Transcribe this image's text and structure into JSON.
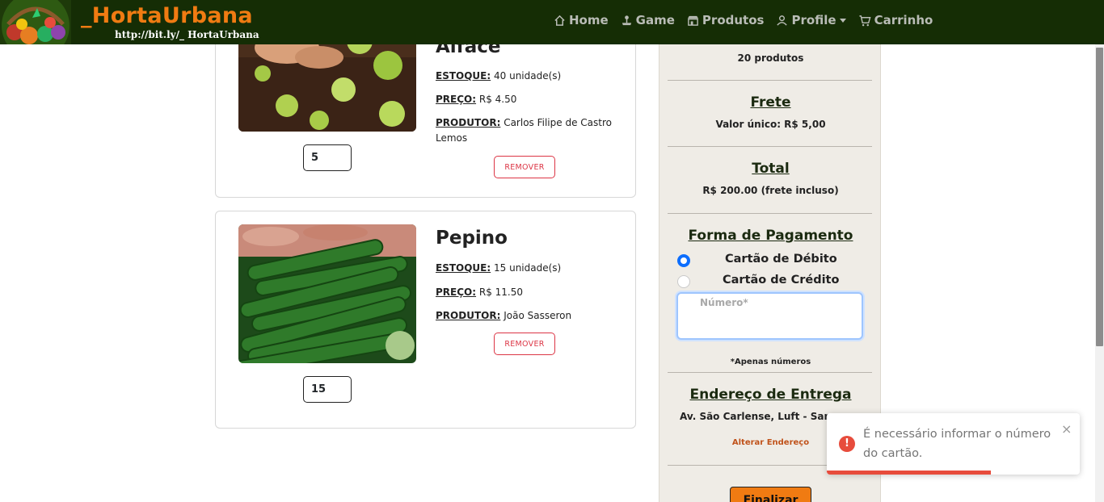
{
  "brand": {
    "name": "_HortaUrbana",
    "url": "http://bit.ly/_ HortaUrbana"
  },
  "nav": [
    {
      "label": "Home",
      "icon": "home-icon"
    },
    {
      "label": "Game",
      "icon": "joystick-icon"
    },
    {
      "label": "Produtos",
      "icon": "shop-icon"
    },
    {
      "label": "Profile",
      "icon": "person-icon"
    },
    {
      "label": "Carrinho",
      "icon": "cart-icon"
    }
  ],
  "cart": [
    {
      "name": "Alface",
      "stock_label": "ESTOQUE:",
      "stock": "40 unidade(s)",
      "price_label": "PREÇO:",
      "price": "R$ 4.50",
      "producer_label": "PRODUTOR:",
      "producer": "Carlos Filipe de Castro Lemos",
      "remove_label": "REMOVER",
      "quantity": "5"
    },
    {
      "name": "Pepino",
      "stock_label": "ESTOQUE:",
      "stock": "15 unidade(s)",
      "price_label": "PREÇO:",
      "price": "R$ 11.50",
      "producer_label": "PRODUTOR:",
      "producer": "João Sasseron",
      "remove_label": "REMOVER",
      "quantity": "15"
    }
  ],
  "summary": {
    "products_count": "20 produtos",
    "frete_title": "Frete",
    "frete_value": "Valor único: R$ 5,00",
    "total_title": "Total",
    "total_value": "R$ 200.00 (frete incluso)",
    "payment_title": "Forma de Pagamento",
    "payment_options": [
      {
        "label": "Cartão de Débito",
        "checked": true
      },
      {
        "label": "Cartão de Crédito",
        "checked": false
      }
    ],
    "card_placeholder": "Número*",
    "card_hint": "*Apenas números",
    "address_title": "Endereço de Entrega",
    "address": "Av. São Carlense, Luft - Sanc",
    "alter_address": "Alterar Endereço",
    "finalize": "Finalizar"
  },
  "toast": {
    "message": "É necessário informar o número do cartão.",
    "close": "×",
    "icon": "!",
    "progress": 0.65,
    "color": "#e74c3c"
  },
  "colors": {
    "navbar": "#152d05",
    "brand": "#f07b12",
    "accent": "#0d6efd",
    "danger": "#dc3545"
  }
}
